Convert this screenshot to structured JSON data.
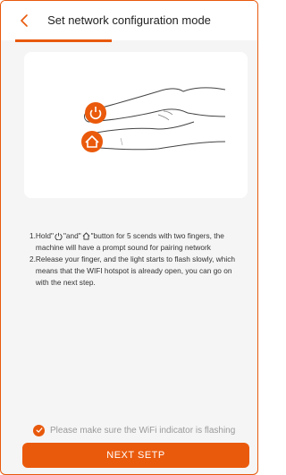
{
  "header": {
    "back_icon": "chevron-left-icon",
    "title": "Set network configuration mode"
  },
  "illustration": {
    "icons": [
      "power-icon",
      "home-icon"
    ]
  },
  "instructions": {
    "step1": {
      "number": "1.",
      "prefix": "Hold\"",
      "middle": "\"and\"",
      "suffix": "\"button for 5 scends with two fingers, the machine will have a prompt sound for pairing network"
    },
    "step2": {
      "number": "2.",
      "text": "Release your finger, and the light starts to flash slowly, which means that the WIFI hotspot is already open, you can go on with the next step."
    }
  },
  "confirm": {
    "text": "Please make sure the WiFi indicator is flashing",
    "checked": true
  },
  "next_button": {
    "label": "NEXT SETP"
  },
  "colors": {
    "accent": "#ea5a0c",
    "background": "#f5f5f5",
    "card": "#ffffff"
  }
}
